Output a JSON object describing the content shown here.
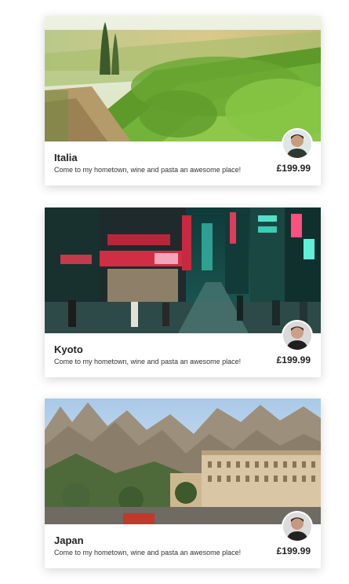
{
  "cards": [
    {
      "title": "Italia",
      "description": "Come to my hometown, wine and pasta an awesome place!",
      "price": "£199.99",
      "image": "vineyard-photo",
      "avatar": "host-avatar"
    },
    {
      "title": "Kyoto",
      "description": "Come to my hometown, wine and pasta an awesome place!",
      "price": "£199.99",
      "image": "neon-street-photo",
      "avatar": "host-avatar"
    },
    {
      "title": "Japan",
      "description": "Come to my hometown, wine and pasta an awesome place!",
      "price": "£199.99",
      "image": "mountain-monastery-photo",
      "avatar": "host-avatar"
    }
  ]
}
